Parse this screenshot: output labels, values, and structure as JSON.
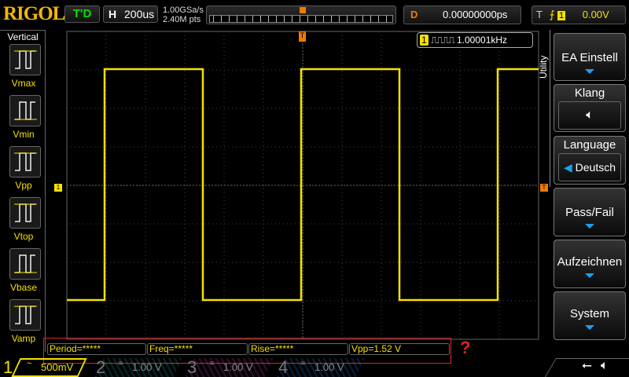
{
  "brand": "RIGOL",
  "status": {
    "run_state": "T'D",
    "horizontal_label": "H",
    "timebase": "200us",
    "sample_rate": "1.00GSa/s",
    "memory_depth": "2.40M pts",
    "delay_label": "D",
    "delay": "0.00000000ps",
    "trigger_label": "T",
    "trigger_source": "1",
    "trigger_level": "0.00V"
  },
  "left_menu": {
    "title": "Vertical",
    "items": [
      {
        "label": "Vmax"
      },
      {
        "label": "Vmin"
      },
      {
        "label": "Vpp"
      },
      {
        "label": "Vtop"
      },
      {
        "label": "Vbase"
      },
      {
        "label": "Vamp"
      }
    ]
  },
  "frequency_counter": {
    "channel": "1",
    "value": "1.00001kHz"
  },
  "right_menu": {
    "title": "Utility",
    "buttons": [
      {
        "label": "EA Einstell"
      },
      {
        "label": "Klang"
      },
      {
        "label": "Language",
        "value": "Deutsch"
      },
      {
        "label": "Pass/Fail"
      },
      {
        "label": "Aufzeichnen"
      },
      {
        "label": "System"
      }
    ]
  },
  "measurements": [
    {
      "text": "Period=*****"
    },
    {
      "text": "Freq=*****"
    },
    {
      "text": "Rise=*****"
    },
    {
      "text": "Vpp=1.52 V"
    }
  ],
  "help_icon": "?",
  "channels": [
    {
      "num": "1",
      "coupling": "~",
      "scale": "500mV",
      "color": "#f5e000"
    },
    {
      "num": "2",
      "coupling": "=",
      "scale": "1.00 V",
      "color": "#00c0c0"
    },
    {
      "num": "3",
      "coupling": "=",
      "scale": "1.00 V",
      "color": "#e040e0"
    },
    {
      "num": "4",
      "coupling": "=",
      "scale": "1.00 V",
      "color": "#1e90ff"
    }
  ],
  "waveform": {
    "type": "square",
    "frequency": "1.00001kHz",
    "trace_color": "#f5e000"
  }
}
